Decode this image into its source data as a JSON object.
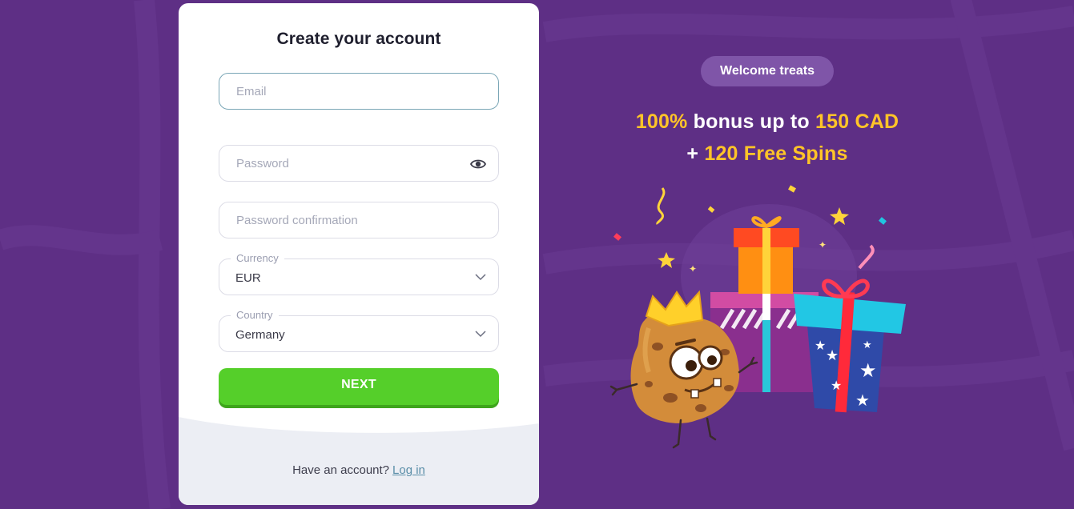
{
  "form": {
    "title": "Create your account",
    "email": {
      "placeholder": "Email",
      "value": ""
    },
    "password": {
      "placeholder": "Password",
      "value": ""
    },
    "password_confirmation": {
      "placeholder": "Password confirmation",
      "value": ""
    },
    "currency": {
      "label": "Currency",
      "value": "EUR"
    },
    "country": {
      "label": "Country",
      "value": "Germany"
    },
    "next_label": "NEXT",
    "footer_text": "Have an account?",
    "login_link": "Log in"
  },
  "promo": {
    "badge": "Welcome treats",
    "line1": {
      "highlight_1": "100%",
      "text": "bonus up to",
      "highlight_2": "150 CAD"
    },
    "line2": {
      "prefix": "+",
      "highlight": "120 Free Spins"
    }
  },
  "icons": {
    "password_toggle": "eye-icon",
    "select_arrow": "chevron-down-icon"
  },
  "colors": {
    "background": "#5e2f85",
    "accent_button": "#55cf2a",
    "promo_highlight": "#ffc428",
    "badge": "#7f55a8",
    "link": "#5a8ea8"
  }
}
